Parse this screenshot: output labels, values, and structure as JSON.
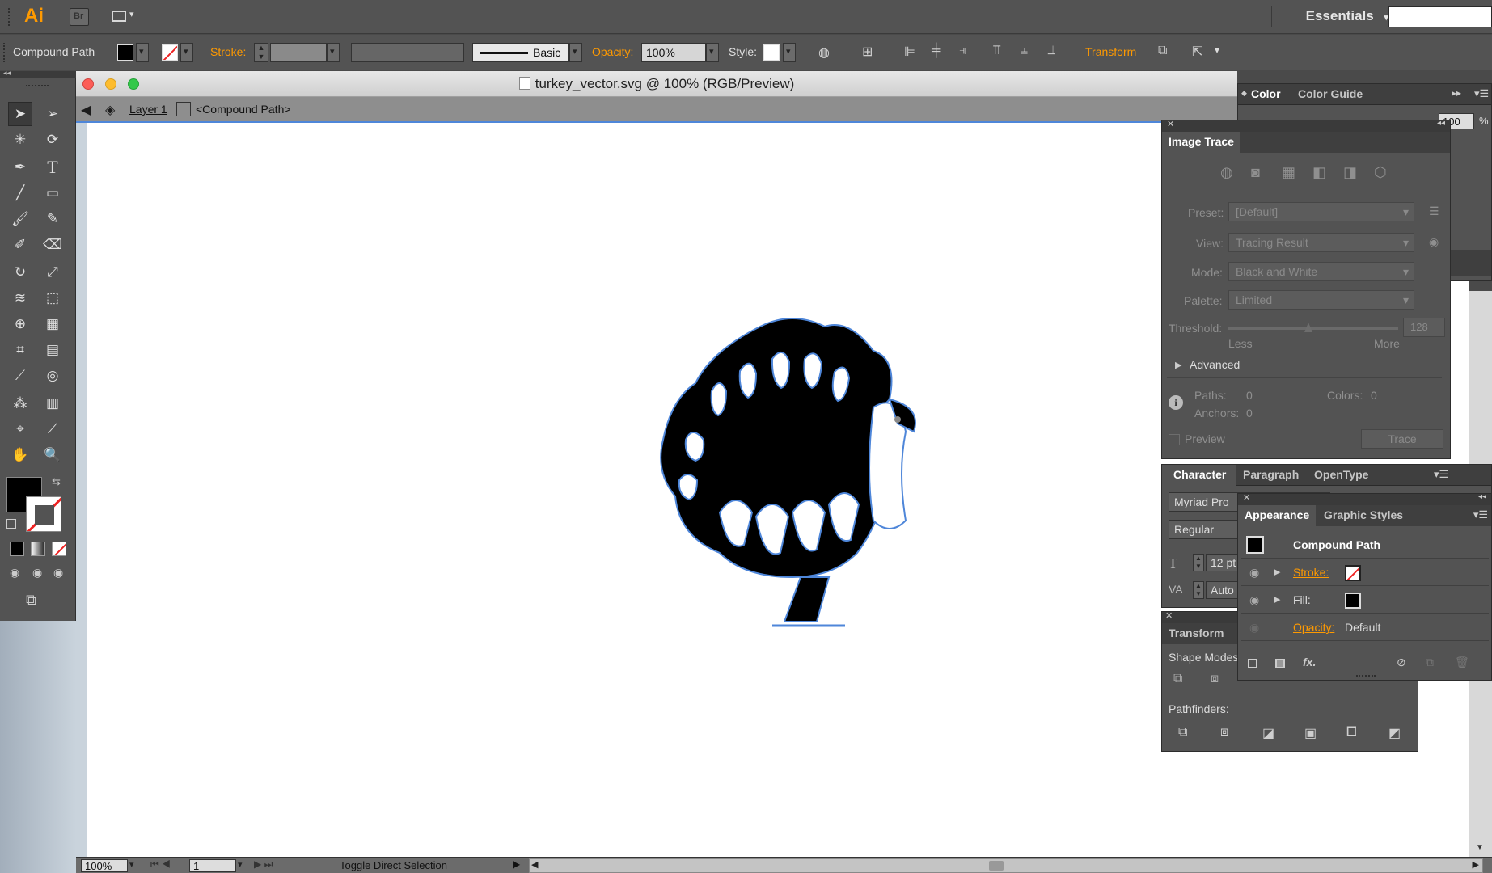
{
  "app": {
    "logo": "Ai",
    "bridge_label": "Br",
    "workspace": "Essentials"
  },
  "control_bar": {
    "selection_type": "Compound Path",
    "stroke_label": "Stroke:",
    "stroke_profile": "Basic",
    "opacity_label": "Opacity:",
    "opacity_value": "100%",
    "style_label": "Style:",
    "transform_label": "Transform"
  },
  "document": {
    "title": "turkey_vector.svg @ 100% (RGB/Preview)",
    "layer": "Layer 1",
    "object": "<Compound Path>"
  },
  "status_bar": {
    "zoom": "100%",
    "artboard": "1",
    "message": "Toggle Direct Selection"
  },
  "color_panel": {
    "tabs": [
      "Color",
      "Color Guide"
    ],
    "value": "100",
    "unit": "%"
  },
  "image_trace": {
    "title": "Image Trace",
    "preset_label": "Preset:",
    "preset_value": "[Default]",
    "view_label": "View:",
    "view_value": "Tracing Result",
    "mode_label": "Mode:",
    "mode_value": "Black and White",
    "palette_label": "Palette:",
    "palette_value": "Limited",
    "threshold_label": "Threshold:",
    "threshold_value": "128",
    "less": "Less",
    "more": "More",
    "advanced": "Advanced",
    "paths_label": "Paths:",
    "paths_value": "0",
    "colors_label": "Colors:",
    "colors_value": "0",
    "anchors_label": "Anchors:",
    "anchors_value": "0",
    "preview_label": "Preview",
    "trace_button": "Trace"
  },
  "character_panel": {
    "tabs": [
      "Character",
      "Paragraph",
      "OpenType"
    ],
    "font": "Myriad Pro",
    "style": "Regular",
    "size": "12 pt",
    "leading": "Auto"
  },
  "appearance_panel": {
    "tabs": [
      "Appearance",
      "Graphic Styles"
    ],
    "object": "Compound Path",
    "stroke_label": "Stroke:",
    "fill_label": "Fill:",
    "opacity_label": "Opacity:",
    "opacity_value": "Default"
  },
  "pathfinder_panel": {
    "tab": "Transform",
    "shape_modes": "Shape Modes:",
    "pathfinders": "Pathfinders:"
  },
  "colors": {
    "accent": "#ff9a00",
    "selection": "#4e86d9"
  }
}
